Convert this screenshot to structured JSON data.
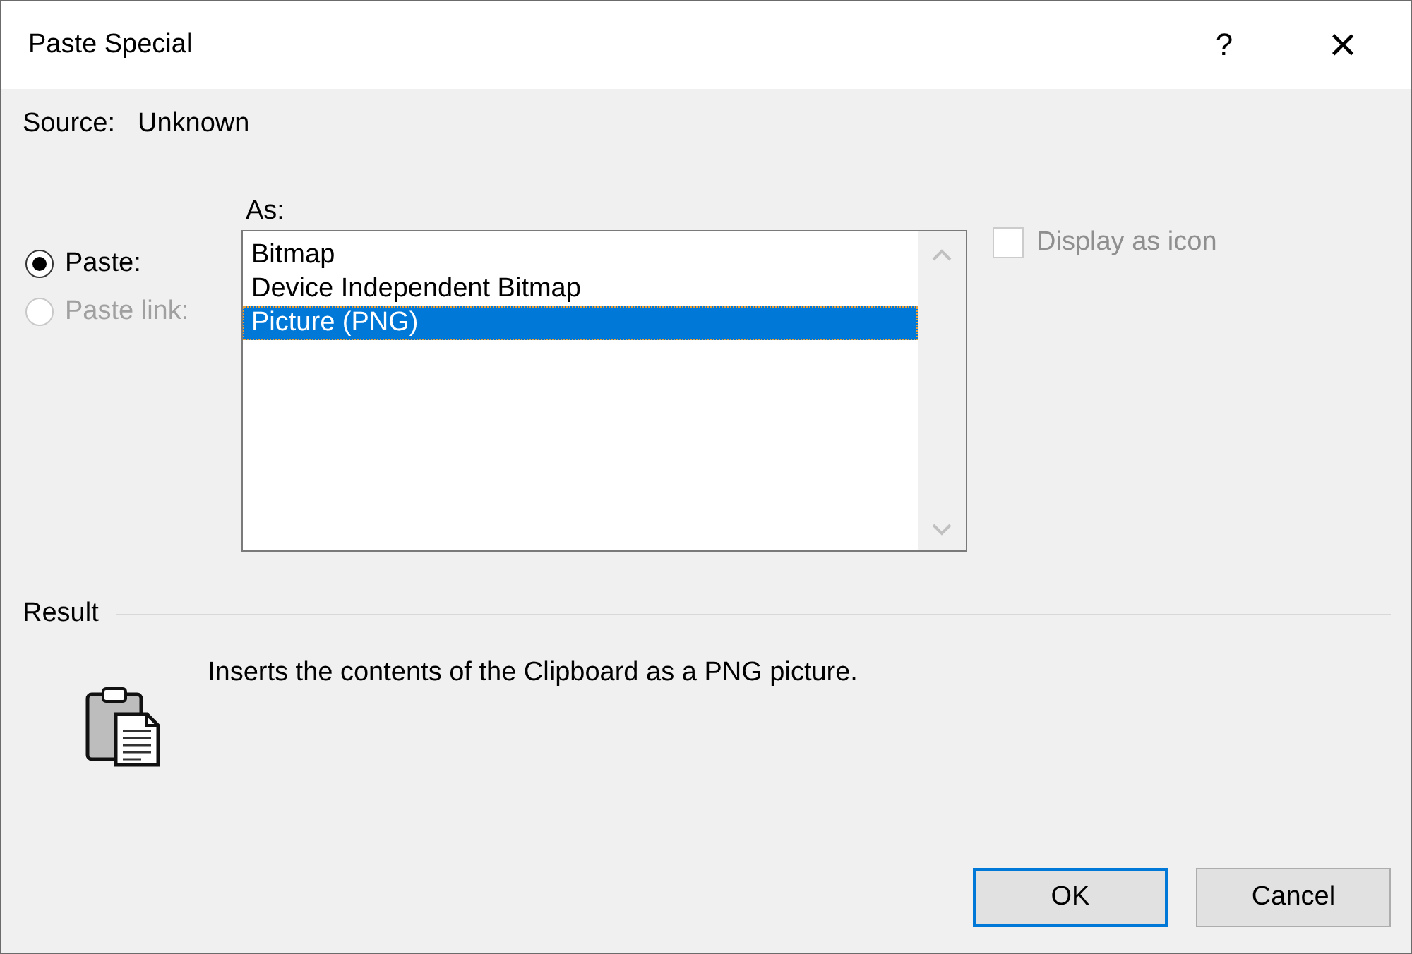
{
  "window": {
    "title": "Paste Special",
    "help": "?",
    "close": "×"
  },
  "source": {
    "label": "Source:",
    "value": "Unknown"
  },
  "paste_options": [
    {
      "label": "Paste:",
      "selected": true,
      "disabled": false
    },
    {
      "label": "Paste link:",
      "selected": false,
      "disabled": true
    }
  ],
  "as_list": {
    "label": "As:",
    "items": [
      {
        "label": "Bitmap",
        "selected": false
      },
      {
        "label": "Device Independent Bitmap",
        "selected": false
      },
      {
        "label": "Picture (PNG)",
        "selected": true
      }
    ]
  },
  "display_as_icon": {
    "label": "Display as icon",
    "checked": false,
    "disabled": true
  },
  "result": {
    "label": "Result",
    "description": "Inserts the contents of the Clipboard as a PNG picture."
  },
  "buttons": [
    {
      "label": "OK",
      "default": true
    },
    {
      "label": "Cancel",
      "default": false
    }
  ]
}
